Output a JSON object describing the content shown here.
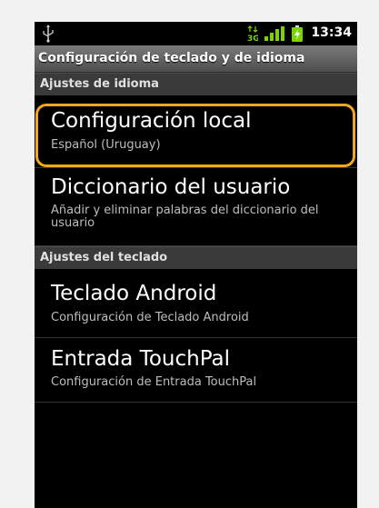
{
  "status_bar": {
    "time": "13:34",
    "network_type": "3G",
    "icons": [
      "usb-icon",
      "network-3g-icon",
      "signal-icon",
      "battery-charging-icon"
    ],
    "battery_color": "#7cd300",
    "signal_color": "#7cd300"
  },
  "title_bar": {
    "title": "Configuración de teclado y de idioma"
  },
  "sections": [
    {
      "header": "Ajustes de idioma",
      "items": [
        {
          "title": "Configuración local",
          "summary": "Español (Uruguay)",
          "highlighted": true
        },
        {
          "title": "Diccionario del usuario",
          "summary": "Añadir y eliminar palabras del diccionario del usuario"
        }
      ]
    },
    {
      "header": "Ajustes del teclado",
      "items": [
        {
          "title": "Teclado Android",
          "summary": "Configuración de Teclado Android"
        },
        {
          "title": "Entrada TouchPal",
          "summary": "Configuración de Entrada TouchPal"
        }
      ]
    }
  ],
  "highlight_color": "#f2a81b"
}
